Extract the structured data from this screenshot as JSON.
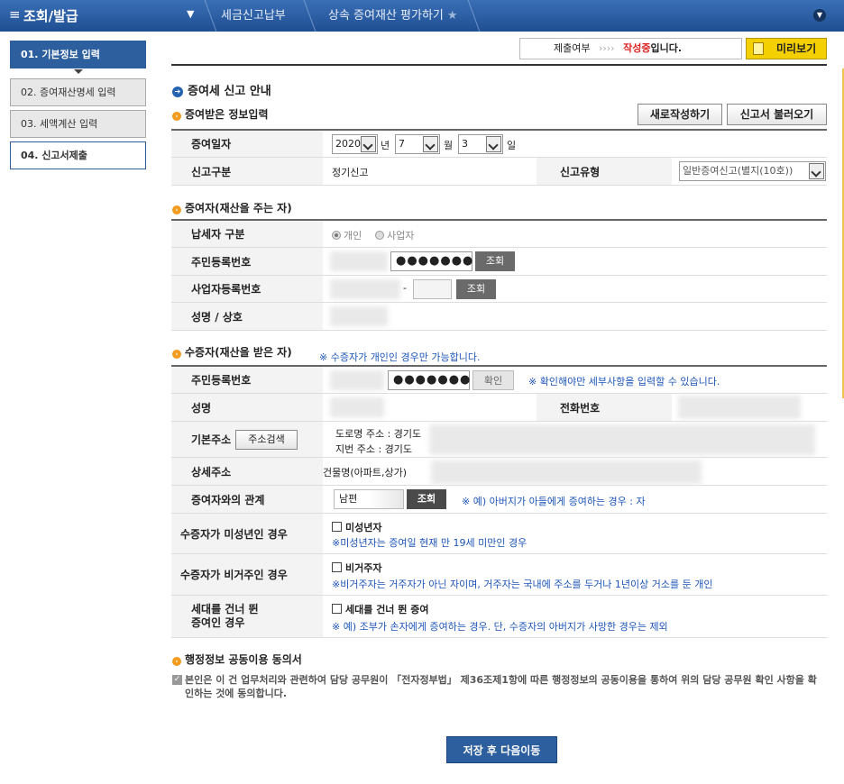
{
  "topbar": {
    "menu_title": "조회/발급",
    "crumbs": [
      "세금신고납부",
      "상속 증여재산 평가하기"
    ]
  },
  "sidebar": {
    "items": [
      {
        "label": "01. 기본정보 입력"
      },
      {
        "label": "02. 증여재산명세 입력"
      },
      {
        "label": "03. 세액계산 입력"
      },
      {
        "label": "04. 신고서제출"
      }
    ]
  },
  "status": {
    "label": "제출여부",
    "arrows": "››››",
    "value_red": "작성중",
    "value_suffix": "입니다."
  },
  "preview_label": "미리보기",
  "page_title": "증여세 신고 안내",
  "section_gift_info": {
    "title": "증여받은 정보입력",
    "new_button": "새로작성하기",
    "load_button": "신고서 불러오기",
    "date_label": "증여일자",
    "year": "2020",
    "year_unit": "년",
    "month": "7",
    "month_unit": "월",
    "day": "3",
    "day_unit": "일",
    "report_class_label": "신고구분",
    "report_class_value": "정기신고",
    "report_type_label": "신고유형",
    "report_type_value": "일반증여신고(별지(10호))"
  },
  "section_donor": {
    "title": "증여자(재산을 주는 자)",
    "taxpayer_type_label": "납세자 구분",
    "radio_person": "개인",
    "radio_business": "사업자",
    "rrn_label": "주민등록번호",
    "rrn_masked": "●●●●●●●",
    "lookup_button": "조회",
    "brn_label": "사업자등록번호",
    "brn_dash": "-",
    "lookup_button2": "조회",
    "name_label": "성명 / 상호"
  },
  "section_donee": {
    "title": "수증자(재산을 받은 자)",
    "title_note": "※ 수증자가 개인인 경우만 가능합니다.",
    "rrn_label": "주민등록번호",
    "rrn_masked": "●●●●●●●",
    "confirm_button": "확인",
    "confirm_note": "※ 확인해야만 세부사항을 입력할 수 있습니다.",
    "name_label": "성명",
    "phone_label": "전화번호",
    "address_label": "기본주소",
    "address_search_button": "주소검색",
    "road_addr": "도로명 주소 :  경기도",
    "lot_addr": "지번 주소 :  경기도",
    "detail_label": "상세주소",
    "detail_value": "건물명(아파트,상가)",
    "relation_label": "증여자와의 관계",
    "relation_value": "남편",
    "relation_button": "조회",
    "relation_note": "※ 예) 아버지가 아들에게 증여하는 경우 : 자",
    "minor_label": "수증자가 미성년인 경우",
    "minor_check": "미성년자",
    "minor_note": "※미성년자는 증여일 현재 만 19세 미만인 경우",
    "nonres_label": "수증자가 비거주인 경우",
    "nonres_check": "비거주자",
    "nonres_note": "※비거주자는 거주자가 아닌 자이며, 거주자는 국내에 주소를 두거나 1년이상 거소를 둔 개인",
    "skip_label_1": "세대를 건너 뛴",
    "skip_label_2": "증여인 경우",
    "skip_check": "세대를 건너 뛴 증여",
    "skip_note": "※ 예) 조부가 손자에게 증여하는 경우. 단, 수증자의 아버지가 사망한 경우는 제외"
  },
  "section_consent": {
    "title": "행정정보 공동이용 동의서",
    "text": "본인은 이 건 업무처리와 관련하여 담당 공무원이 「전자정부법」 제36조제1항에 따른 행정정보의 공동이용을 통하여 위의 담당 공무원 확인 사항을 확인하는 것에 동의합니다."
  },
  "save_button": "저장 후 다음이동",
  "colors": {
    "primary": "#2d5f9e",
    "accent_yellow": "#f5d000",
    "status_red": "#dd2222",
    "note_blue": "#1d55b8"
  }
}
